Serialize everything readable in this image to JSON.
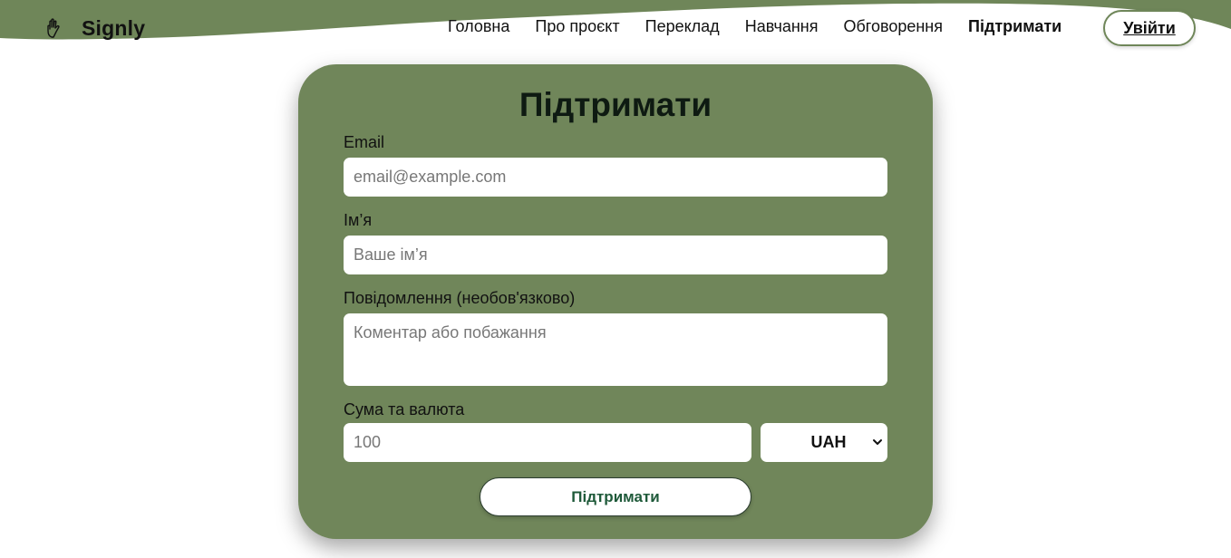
{
  "header": {
    "brand": "Signly",
    "logo_icon": "hand-sign-icon",
    "nav": [
      {
        "label": "Головна"
      },
      {
        "label": "Про проєкт"
      },
      {
        "label": "Переклад"
      },
      {
        "label": "Навчання"
      },
      {
        "label": "Обговорення"
      },
      {
        "label": "Підтримати"
      }
    ],
    "login_label": "Увійти"
  },
  "colors": {
    "accent_green": "#70865a",
    "wave_green": "#6f8659",
    "button_text": "#1f5a3a"
  },
  "form": {
    "title": "Підтримати",
    "email": {
      "label": "Email",
      "placeholder": "email@example.com",
      "value": ""
    },
    "name": {
      "label": "Ім’я",
      "placeholder": "Ваше ім’я",
      "value": ""
    },
    "message": {
      "label": "Повідомлення (необов'язково)",
      "placeholder": "Коментар або побажання",
      "value": ""
    },
    "amount": {
      "label": "Сума та валюта",
      "placeholder": "100",
      "value": ""
    },
    "currency": {
      "selected": "UAH"
    },
    "submit_label": "Підтримати"
  }
}
